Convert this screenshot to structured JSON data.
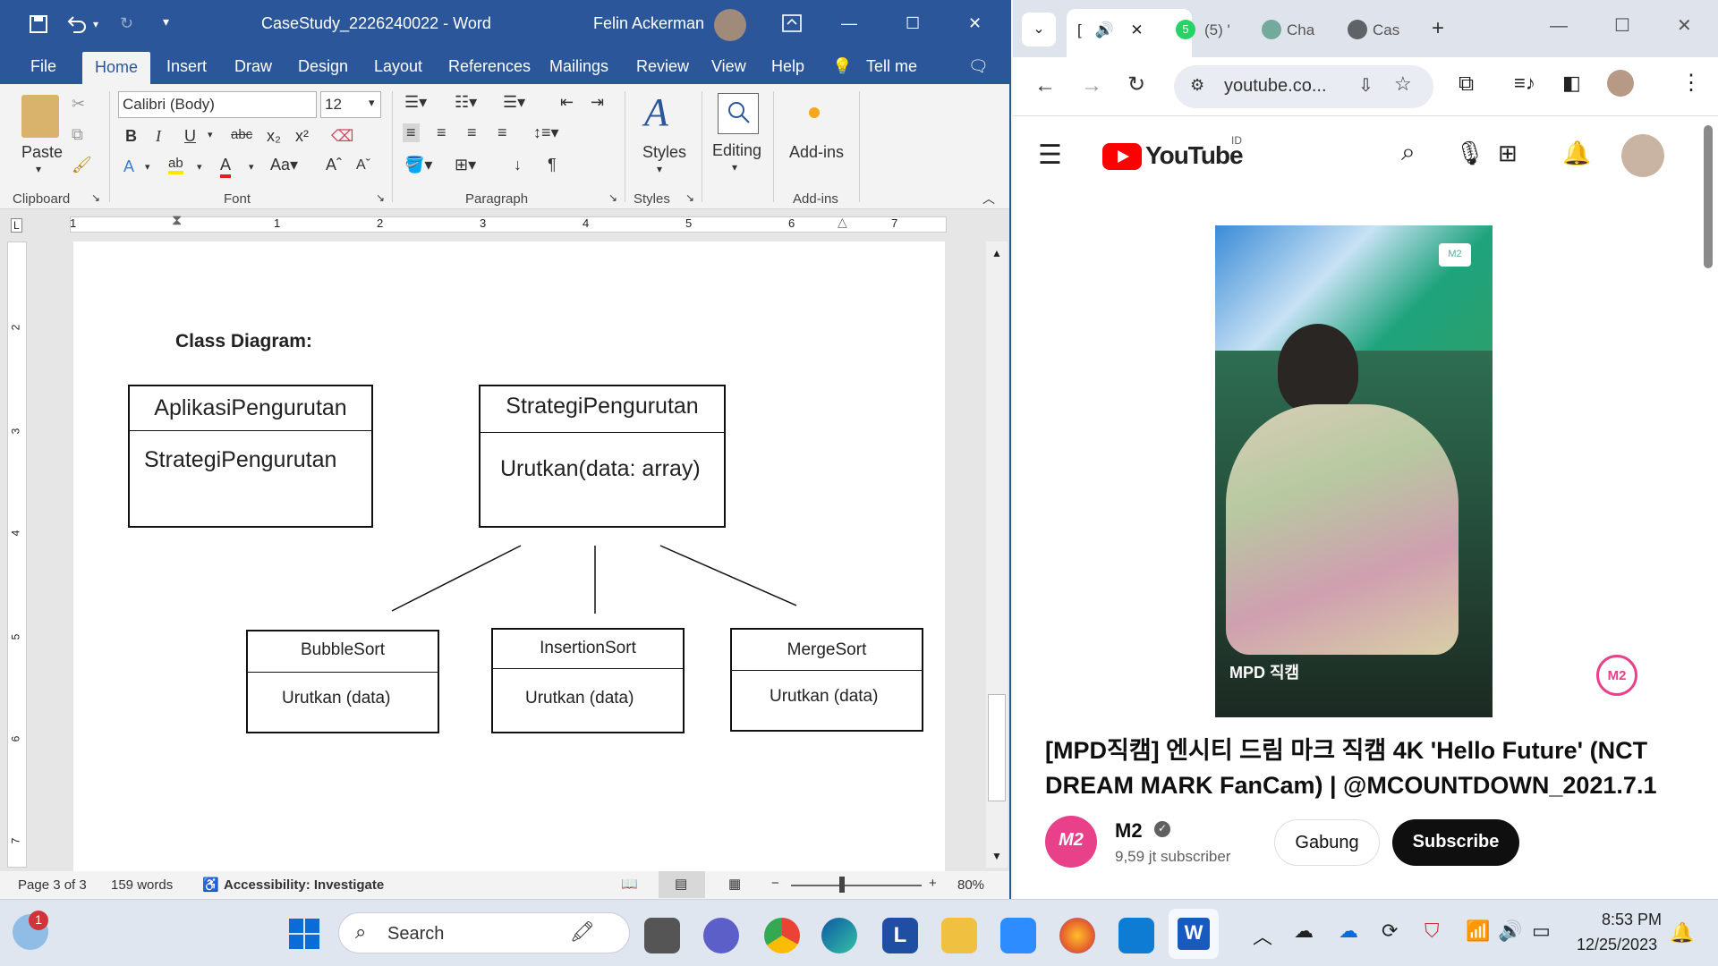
{
  "word": {
    "doc_title": "CaseStudy_2226240022  -  Word",
    "user_name": "Felin Ackerman",
    "tabs": [
      "File",
      "Home",
      "Insert",
      "Draw",
      "Design",
      "Layout",
      "References",
      "Mailings",
      "Review",
      "View",
      "Help"
    ],
    "tell_me": "Tell me",
    "font_name": "Calibri (Body)",
    "font_size": "12",
    "paste_label": "Paste",
    "styles_label": "Styles",
    "editing_label": "Editing",
    "addins_label": "Add-ins",
    "group_labels": {
      "clipboard": "Clipboard",
      "font": "Font",
      "paragraph": "Paragraph",
      "styles": "Styles",
      "addins": "Add-ins"
    },
    "ruler_numbers": [
      "1",
      "1",
      "2",
      "3",
      "4",
      "5",
      "6",
      "7"
    ],
    "vruler_numbers": [
      "2",
      "3",
      "4",
      "5",
      "6",
      "7"
    ],
    "status": {
      "page": "Page 3 of 3",
      "words": "159 words",
      "accessibility": "Accessibility: Investigate",
      "zoom": "80%"
    }
  },
  "diagram": {
    "heading": "Class Diagram:",
    "aplikasi": {
      "header": "AplikasiPengurutan",
      "body": "StrategiPengurutan"
    },
    "strategi": {
      "header": "StrategiPengurutan",
      "body": "Urutkan(data: array)"
    },
    "bubble": {
      "header": "BubbleSort",
      "body": "Urutkan (data)"
    },
    "insertion": {
      "header": "InsertionSort",
      "body": "Urutkan (data)"
    },
    "merge": {
      "header": "MergeSort",
      "body": "Urutkan (data)"
    }
  },
  "chrome": {
    "tabs": [
      {
        "label": "[",
        "active": true
      },
      {
        "label": "(5) '",
        "active": false
      },
      {
        "label": "Cha",
        "active": false
      },
      {
        "label": "Cas",
        "active": false
      }
    ],
    "whatsapp_badge": "5",
    "url": "youtube.co...",
    "yt_logo_text": "YouTube",
    "yt_region": "ID",
    "video_title": "[MPD직캠] 엔시티 드림 마크 직캠 4K 'Hello Future' (NCT DREAM MARK FanCam) | @MCOUNTDOWN_2021.7.1",
    "channel_name": "M2",
    "subscribers": "9,59 jt subscriber",
    "join_label": "Gabung",
    "subscribe_label": "Subscribe",
    "video_watermark": "MPD 직캠",
    "channel_logo_text": "M2"
  },
  "taskbar": {
    "search_placeholder": "Search",
    "time": "8:53 PM",
    "date": "12/25/2023",
    "weather_badge": "1"
  },
  "colors": {
    "word_blue": "#2b579a",
    "yt_red": "#ff0000",
    "m2_pink": "#e8418a"
  }
}
